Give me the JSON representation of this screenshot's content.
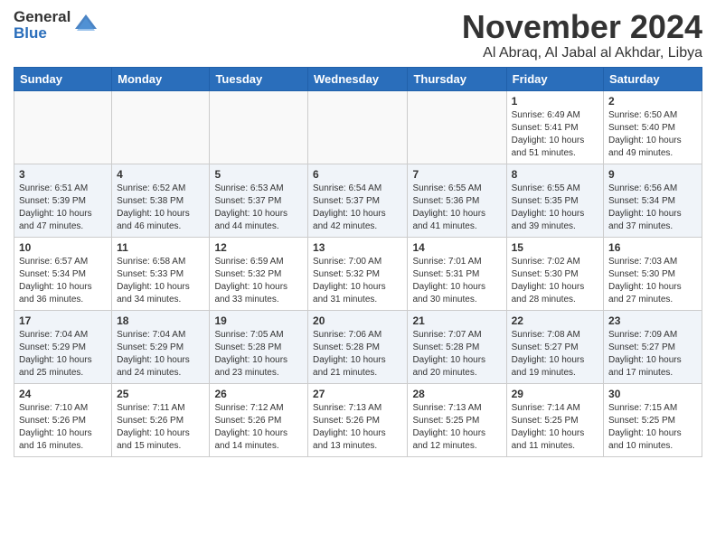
{
  "header": {
    "logo_line1": "General",
    "logo_line2": "Blue",
    "month": "November 2024",
    "location": "Al Abraq, Al Jabal al Akhdar, Libya"
  },
  "weekdays": [
    "Sunday",
    "Monday",
    "Tuesday",
    "Wednesday",
    "Thursday",
    "Friday",
    "Saturday"
  ],
  "weeks": [
    [
      {
        "day": "",
        "info": ""
      },
      {
        "day": "",
        "info": ""
      },
      {
        "day": "",
        "info": ""
      },
      {
        "day": "",
        "info": ""
      },
      {
        "day": "",
        "info": ""
      },
      {
        "day": "1",
        "info": "Sunrise: 6:49 AM\nSunset: 5:41 PM\nDaylight: 10 hours\nand 51 minutes."
      },
      {
        "day": "2",
        "info": "Sunrise: 6:50 AM\nSunset: 5:40 PM\nDaylight: 10 hours\nand 49 minutes."
      }
    ],
    [
      {
        "day": "3",
        "info": "Sunrise: 6:51 AM\nSunset: 5:39 PM\nDaylight: 10 hours\nand 47 minutes."
      },
      {
        "day": "4",
        "info": "Sunrise: 6:52 AM\nSunset: 5:38 PM\nDaylight: 10 hours\nand 46 minutes."
      },
      {
        "day": "5",
        "info": "Sunrise: 6:53 AM\nSunset: 5:37 PM\nDaylight: 10 hours\nand 44 minutes."
      },
      {
        "day": "6",
        "info": "Sunrise: 6:54 AM\nSunset: 5:37 PM\nDaylight: 10 hours\nand 42 minutes."
      },
      {
        "day": "7",
        "info": "Sunrise: 6:55 AM\nSunset: 5:36 PM\nDaylight: 10 hours\nand 41 minutes."
      },
      {
        "day": "8",
        "info": "Sunrise: 6:55 AM\nSunset: 5:35 PM\nDaylight: 10 hours\nand 39 minutes."
      },
      {
        "day": "9",
        "info": "Sunrise: 6:56 AM\nSunset: 5:34 PM\nDaylight: 10 hours\nand 37 minutes."
      }
    ],
    [
      {
        "day": "10",
        "info": "Sunrise: 6:57 AM\nSunset: 5:34 PM\nDaylight: 10 hours\nand 36 minutes."
      },
      {
        "day": "11",
        "info": "Sunrise: 6:58 AM\nSunset: 5:33 PM\nDaylight: 10 hours\nand 34 minutes."
      },
      {
        "day": "12",
        "info": "Sunrise: 6:59 AM\nSunset: 5:32 PM\nDaylight: 10 hours\nand 33 minutes."
      },
      {
        "day": "13",
        "info": "Sunrise: 7:00 AM\nSunset: 5:32 PM\nDaylight: 10 hours\nand 31 minutes."
      },
      {
        "day": "14",
        "info": "Sunrise: 7:01 AM\nSunset: 5:31 PM\nDaylight: 10 hours\nand 30 minutes."
      },
      {
        "day": "15",
        "info": "Sunrise: 7:02 AM\nSunset: 5:30 PM\nDaylight: 10 hours\nand 28 minutes."
      },
      {
        "day": "16",
        "info": "Sunrise: 7:03 AM\nSunset: 5:30 PM\nDaylight: 10 hours\nand 27 minutes."
      }
    ],
    [
      {
        "day": "17",
        "info": "Sunrise: 7:04 AM\nSunset: 5:29 PM\nDaylight: 10 hours\nand 25 minutes."
      },
      {
        "day": "18",
        "info": "Sunrise: 7:04 AM\nSunset: 5:29 PM\nDaylight: 10 hours\nand 24 minutes."
      },
      {
        "day": "19",
        "info": "Sunrise: 7:05 AM\nSunset: 5:28 PM\nDaylight: 10 hours\nand 23 minutes."
      },
      {
        "day": "20",
        "info": "Sunrise: 7:06 AM\nSunset: 5:28 PM\nDaylight: 10 hours\nand 21 minutes."
      },
      {
        "day": "21",
        "info": "Sunrise: 7:07 AM\nSunset: 5:28 PM\nDaylight: 10 hours\nand 20 minutes."
      },
      {
        "day": "22",
        "info": "Sunrise: 7:08 AM\nSunset: 5:27 PM\nDaylight: 10 hours\nand 19 minutes."
      },
      {
        "day": "23",
        "info": "Sunrise: 7:09 AM\nSunset: 5:27 PM\nDaylight: 10 hours\nand 17 minutes."
      }
    ],
    [
      {
        "day": "24",
        "info": "Sunrise: 7:10 AM\nSunset: 5:26 PM\nDaylight: 10 hours\nand 16 minutes."
      },
      {
        "day": "25",
        "info": "Sunrise: 7:11 AM\nSunset: 5:26 PM\nDaylight: 10 hours\nand 15 minutes."
      },
      {
        "day": "26",
        "info": "Sunrise: 7:12 AM\nSunset: 5:26 PM\nDaylight: 10 hours\nand 14 minutes."
      },
      {
        "day": "27",
        "info": "Sunrise: 7:13 AM\nSunset: 5:26 PM\nDaylight: 10 hours\nand 13 minutes."
      },
      {
        "day": "28",
        "info": "Sunrise: 7:13 AM\nSunset: 5:25 PM\nDaylight: 10 hours\nand 12 minutes."
      },
      {
        "day": "29",
        "info": "Sunrise: 7:14 AM\nSunset: 5:25 PM\nDaylight: 10 hours\nand 11 minutes."
      },
      {
        "day": "30",
        "info": "Sunrise: 7:15 AM\nSunset: 5:25 PM\nDaylight: 10 hours\nand 10 minutes."
      }
    ]
  ]
}
